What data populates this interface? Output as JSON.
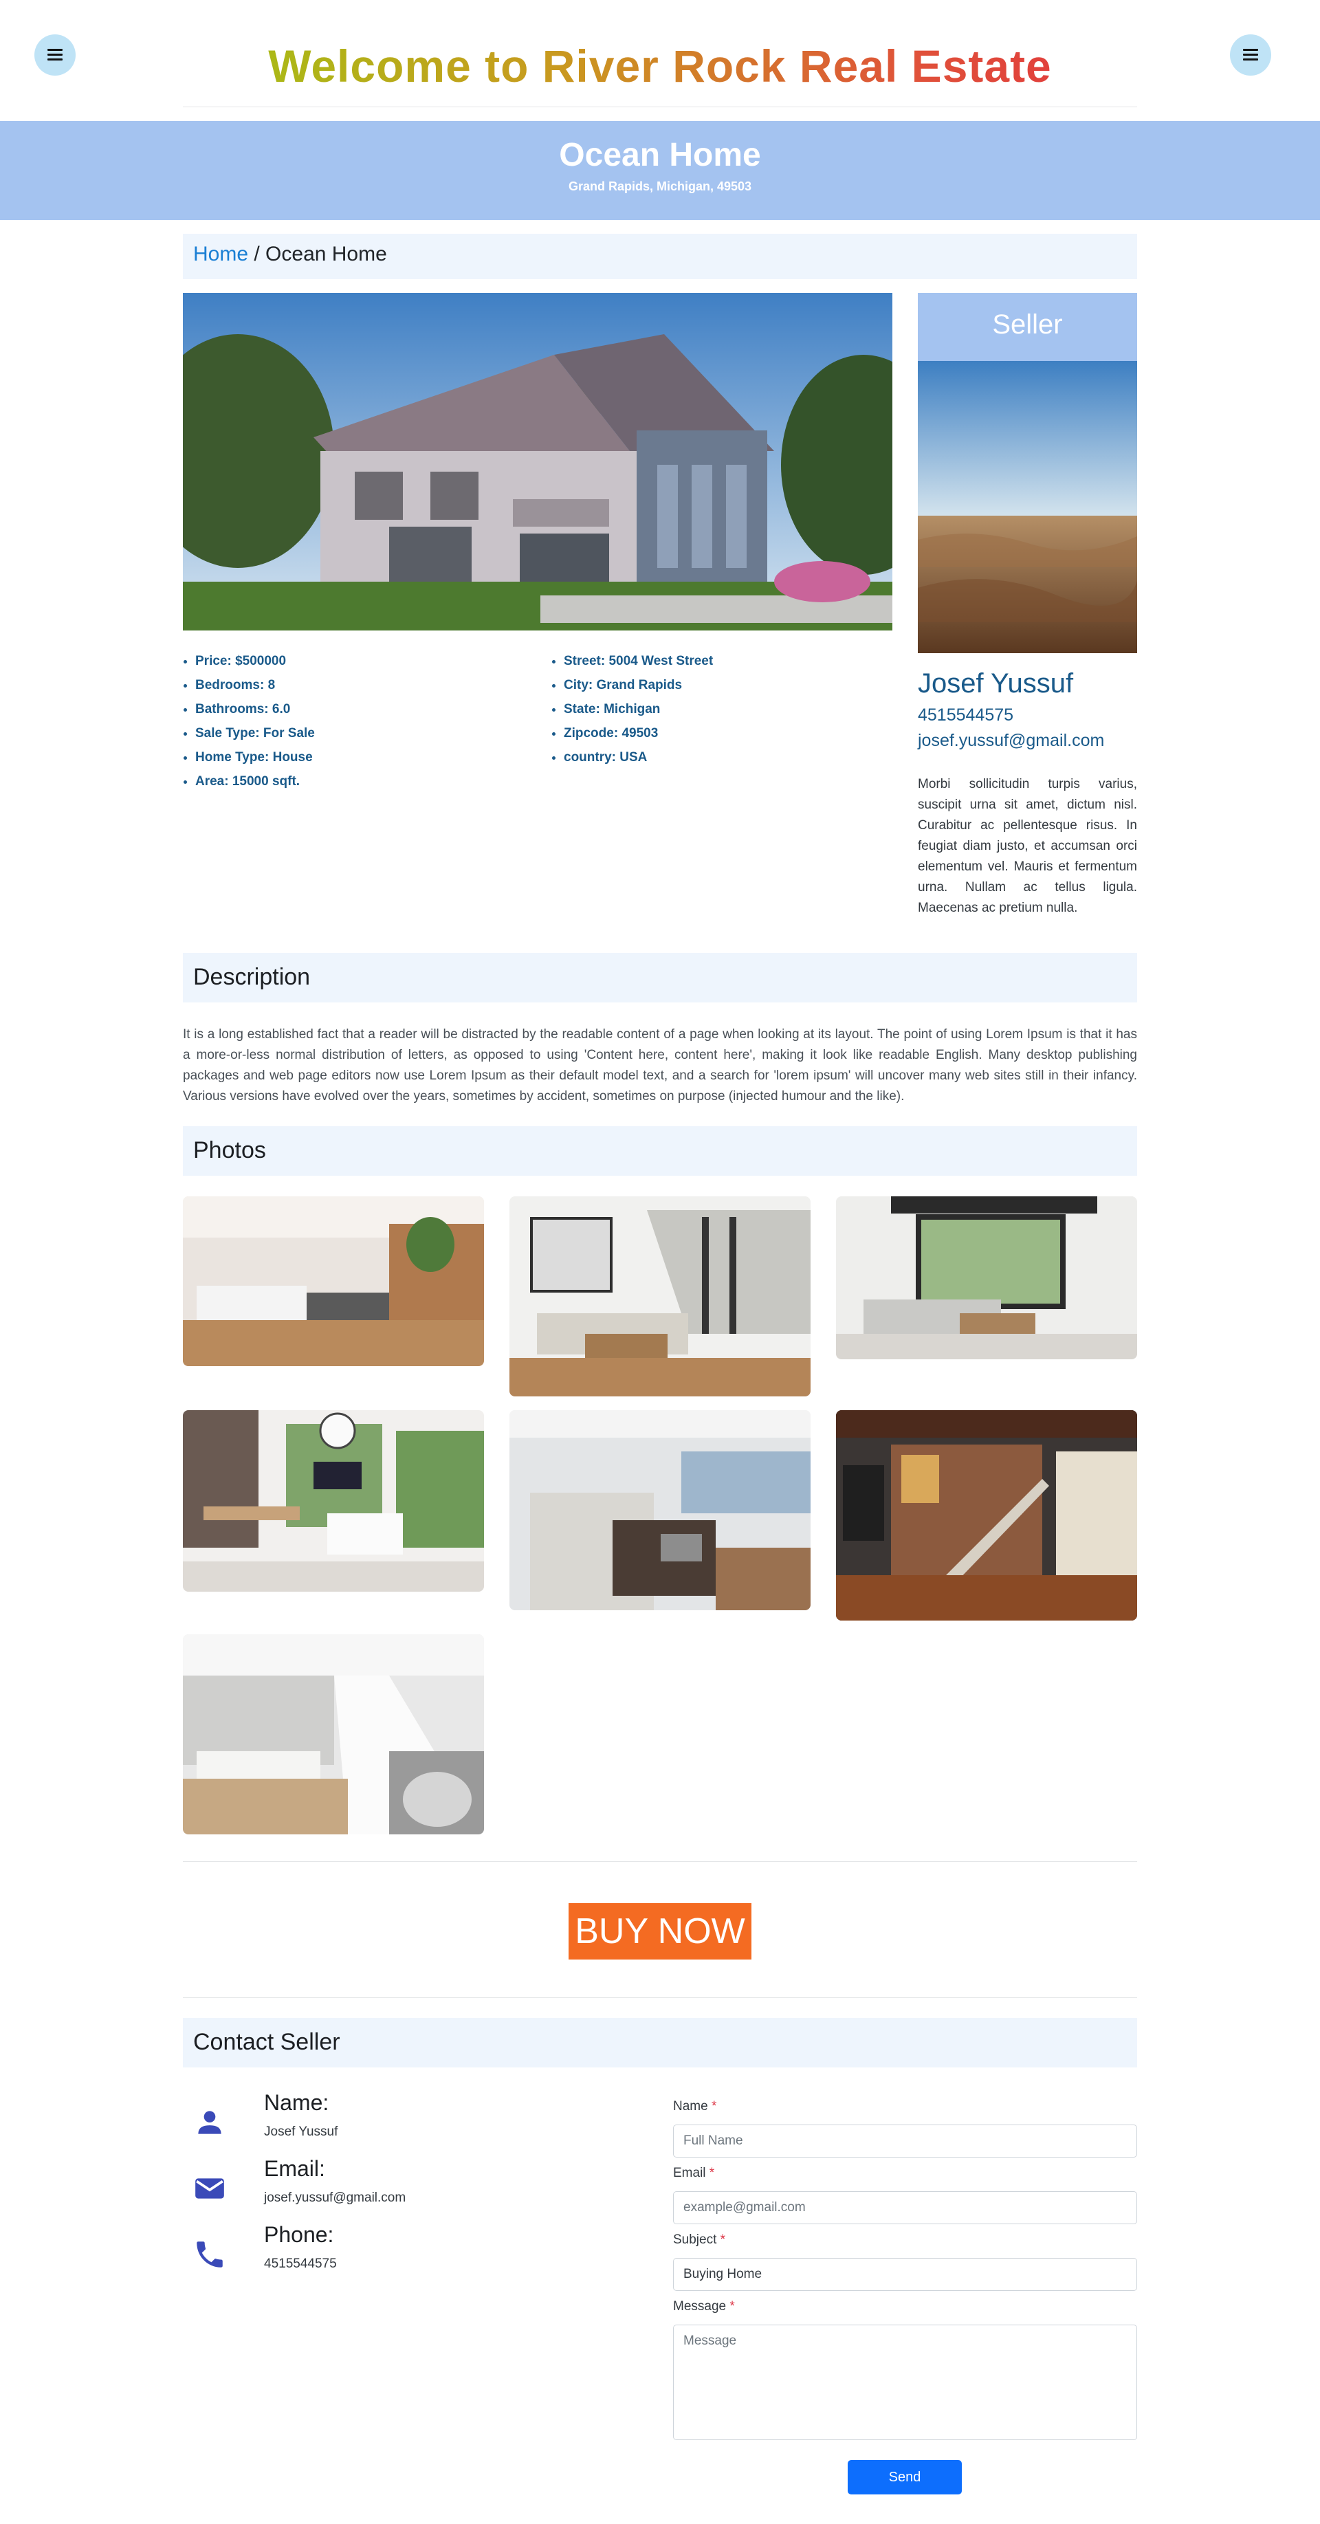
{
  "header": {
    "title": "Welcome to River Rock Real Estate",
    "menu_left_icon": "hamburger-menu-icon",
    "menu_right_icon": "hamburger-menu-icon"
  },
  "hero": {
    "title": "Ocean Home",
    "address": "Grand Rapids, Michigan, 49503"
  },
  "breadcrumb": {
    "home": "Home",
    "separator": " / ",
    "current": "Ocean Home"
  },
  "specs_left": [
    "Price: $500000",
    "Bedrooms: 8",
    "Bathrooms: 6.0",
    "Sale Type: For Sale",
    "Home Type: House",
    "Area: 15000 sqft."
  ],
  "specs_right": [
    "Street: 5004 West Street",
    "City: Grand Rapids",
    "State: Michigan",
    "Zipcode: 49503",
    "country: USA"
  ],
  "seller": {
    "heading": "Seller",
    "name": "Josef Yussuf",
    "phone": "4515544575",
    "email": "josef.yussuf@gmail.com",
    "bio": "Morbi sollicitudin turpis varius, suscipit urna sit amet, dictum nisl. Curabitur ac pellentesque risus. In feugiat diam justo, et accumsan orci elementum vel. Mauris et fermentum urna. Nullam ac tellus ligula. Maecenas ac pretium nulla."
  },
  "description": {
    "heading": "Description",
    "text": "It is a long established fact that a reader will be distracted by the readable content of a page when looking at its layout. The point of using Lorem Ipsum is that it has a more-or-less normal distribution of letters, as opposed to using 'Content here, content here', making it look like readable English. Many desktop publishing packages and web page editors now use Lorem Ipsum as their default model text, and a search for 'lorem ipsum' will uncover many web sites still in their infancy. Various versions have evolved over the years, sometimes by accident, sometimes on purpose (injected humour and the like)."
  },
  "photos": {
    "heading": "Photos"
  },
  "buy_now": "BUY NOW",
  "contact": {
    "heading": "Contact Seller",
    "items": [
      {
        "label": "Name:",
        "value": "Josef Yussuf",
        "icon": "person-icon"
      },
      {
        "label": "Email:",
        "value": "josef.yussuf@gmail.com",
        "icon": "mail-icon"
      },
      {
        "label": "Phone:",
        "value": "4515544575",
        "icon": "phone-icon"
      }
    ]
  },
  "form": {
    "name_label": "Name",
    "name_placeholder": "Full Name",
    "email_label": "Email",
    "email_placeholder": "example@gmail.com",
    "subject_label": "Subject",
    "subject_value": "Buying Home",
    "message_label": "Message",
    "message_placeholder": "Message",
    "required_mark": "*",
    "send_label": "Send"
  },
  "colors": {
    "hero_bg": "#a4c3f0",
    "section_bg": "#eef5fd",
    "link": "#1a7fd4",
    "spec_text": "#1a5a8a",
    "buy_button": "#f46b22",
    "send_button": "#0d6efd",
    "contact_icon": "#3a4ab8",
    "menu_button": "#bfe3f6"
  }
}
